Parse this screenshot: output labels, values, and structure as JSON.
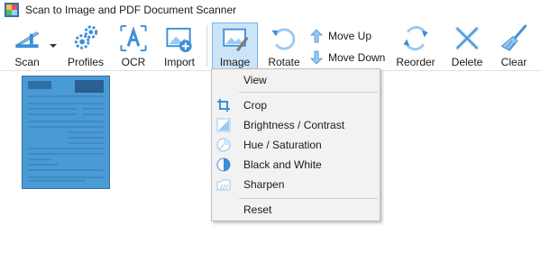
{
  "window": {
    "title": "Scan to Image and PDF Document Scanner"
  },
  "toolbar": {
    "scan": "Scan",
    "profiles": "Profiles",
    "ocr": "OCR",
    "import": "Import",
    "image": "Image",
    "rotate": "Rotate",
    "move_up": "Move Up",
    "move_down": "Move Down",
    "reorder": "Reorder",
    "delete": "Delete",
    "clear": "Clear"
  },
  "icons": {
    "scan": "scanner-icon",
    "profiles": "gears-icon",
    "ocr": "ocr-icon",
    "import": "import-image-icon",
    "image": "image-edit-icon",
    "rotate": "rotate-icon",
    "move_up": "arrow-up-icon",
    "move_down": "arrow-down-icon",
    "reorder": "reorder-icon",
    "delete": "delete-x-icon",
    "clear": "broom-icon"
  },
  "image_menu": {
    "items": [
      {
        "label": "View",
        "icon": ""
      },
      {
        "label": "Crop",
        "icon": "crop-icon"
      },
      {
        "label": "Brightness / Contrast",
        "icon": "brightness-icon"
      },
      {
        "label": "Hue / Saturation",
        "icon": "hue-icon"
      },
      {
        "label": "Black and White",
        "icon": "black-white-icon"
      },
      {
        "label": "Sharpen",
        "icon": "sharpen-icon"
      },
      {
        "label": "Reset",
        "icon": ""
      }
    ]
  },
  "colors": {
    "accent_blue": "#3d8fd6",
    "pressed_bg": "#cce4f7",
    "pressed_border": "#7eb4ea",
    "thumbnail_blue": "#4a9ad6"
  }
}
